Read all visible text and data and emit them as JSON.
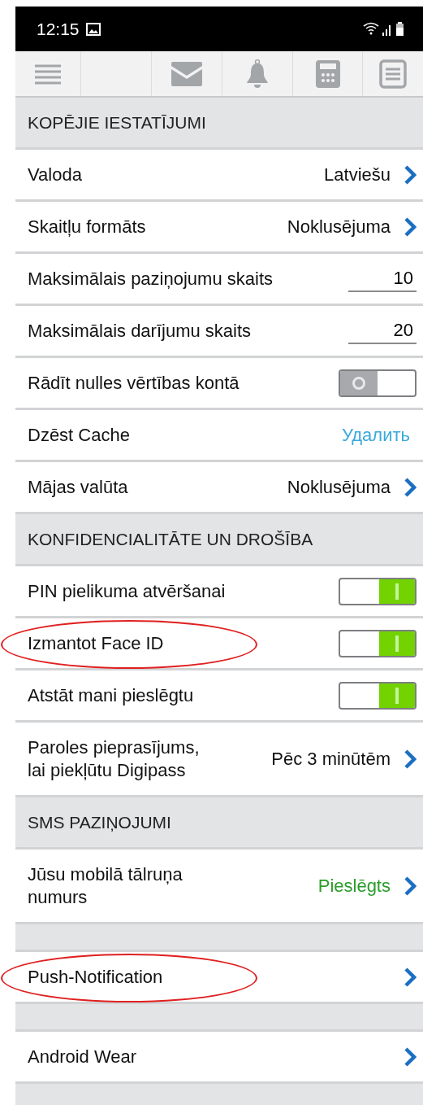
{
  "status_bar": {
    "time": "12:15"
  },
  "sections": [
    {
      "title": "KOPĒJIE IESTATĪJUMI",
      "rows": [
        {
          "kind": "link",
          "label": "Valoda",
          "value": "Latviešu",
          "highlighted": false
        },
        {
          "kind": "link",
          "label": "Skaitļu formāts",
          "value": "Noklusējuma",
          "highlighted": false
        },
        {
          "kind": "input",
          "label": "Maksimālais paziņojumu skaits",
          "value": "10",
          "highlighted": false
        },
        {
          "kind": "input",
          "label": "Maksimālais darījumu skaits",
          "value": "20",
          "highlighted": false
        },
        {
          "kind": "toggle",
          "label": "Rādīt nulles vērtības kontā",
          "on": false,
          "highlighted": false
        },
        {
          "kind": "action",
          "label": "Dzēst Cache",
          "value": "Удалить",
          "highlighted": false
        },
        {
          "kind": "link",
          "label": "Mājas valūta",
          "value": "Noklusējuma",
          "highlighted": false
        }
      ]
    },
    {
      "title": "KONFIDENCIALITĀTE UN DROŠĪBA",
      "rows": [
        {
          "kind": "toggle",
          "label": "PIN pielikuma atvēršanai",
          "on": true,
          "highlighted": false
        },
        {
          "kind": "toggle",
          "label": "Izmantot Face ID",
          "on": true,
          "highlighted": true
        },
        {
          "kind": "toggle",
          "label": "Atstāt mani pieslēgtu",
          "on": true,
          "highlighted": false
        },
        {
          "kind": "link",
          "label": "Paroles pieprasījums, lai piekļūtu Digipass",
          "value": "Pēc 3 minūtēm",
          "highlighted": false
        }
      ]
    },
    {
      "title": "SMS PAZIŅOJUMI",
      "rows": [
        {
          "kind": "link",
          "label": "Jūsu mobilā tālruņa numurs",
          "value": "Pieslēgts",
          "connected": true,
          "highlighted": false
        }
      ]
    },
    {
      "rows": [
        {
          "kind": "link",
          "label": "Push-Notification",
          "highlighted": true
        }
      ]
    },
    {
      "rows": [
        {
          "kind": "link",
          "label": "Android Wear",
          "highlighted": false
        }
      ]
    }
  ]
}
